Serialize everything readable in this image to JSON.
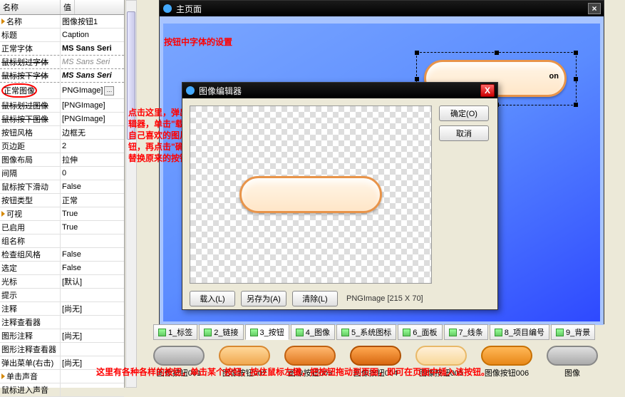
{
  "propGrid": {
    "headers": {
      "name": "名称",
      "value": "值"
    },
    "rows": [
      {
        "l": "名称",
        "r": "图像按钮1",
        "tri": true
      },
      {
        "l": "标题",
        "r": "Caption"
      },
      {
        "l": "正常字体",
        "r": "MS Sans Seri",
        "dash": true,
        "boldR": true
      },
      {
        "l": "鼠标划过字体",
        "r": "MS Sans Seri",
        "dash": true,
        "strikeL": true,
        "italGR": true
      },
      {
        "l": "鼠标按下字体",
        "r": "MS Sans Seri",
        "dash": true,
        "strikeL": true,
        "italBR": true
      },
      {
        "l": "正常图像",
        "r": "PNGImage]",
        "circleL": true,
        "dots": true
      },
      {
        "l": "鼠标划过图像",
        "r": "[PNGImage]",
        "strikeL": true
      },
      {
        "l": "鼠标按下图像",
        "r": "[PNGImage]",
        "strikeL": true
      },
      {
        "l": "按钮风格",
        "r": "边框无"
      },
      {
        "l": "页边距",
        "r": "2"
      },
      {
        "l": "图像布局",
        "r": "拉伸"
      },
      {
        "l": "间隔",
        "r": "0"
      },
      {
        "l": "鼠标按下滑动",
        "r": "False"
      },
      {
        "l": "按钮类型",
        "r": "正常"
      },
      {
        "l": "可视",
        "r": "True",
        "tri": true
      },
      {
        "l": "已启用",
        "r": "True"
      },
      {
        "l": "组名称",
        "r": ""
      },
      {
        "l": "检查组风格",
        "r": "False"
      },
      {
        "l": "选定",
        "r": "False"
      },
      {
        "l": "光标",
        "r": "[默认]"
      },
      {
        "l": "提示",
        "r": ""
      },
      {
        "l": "注释",
        "r": "[尚无]"
      },
      {
        "l": "注释查看器",
        "r": ""
      },
      {
        "l": "图形注释",
        "r": "[尚无]"
      },
      {
        "l": "图形注释查看器",
        "r": ""
      },
      {
        "l": "弹出菜单(右击)",
        "r": "[尚无]"
      },
      {
        "l": "单击声音",
        "r": "",
        "tri": true
      },
      {
        "l": "鼠标进入声音",
        "r": ""
      }
    ]
  },
  "mainWin": {
    "title": "主页面",
    "btnCaption": "on"
  },
  "note1": "按钮中字体的设置",
  "note2": "点击这里，弹出图像编辑器，单击\"载入\"选择自己喜欢的图片或按钮，再点击\"确定\"即可替换原来的按钮。",
  "imgEditor": {
    "title": "图像编辑器",
    "ok": "确定(O)",
    "cancel": "取消",
    "load": "载入(L)",
    "saveas": "另存为(A)",
    "clear": "清除(L)",
    "info": "PNGImage  [215 X 70]"
  },
  "tabs": [
    "1_标签",
    "2_链接",
    "3_按钮",
    "4_图像",
    "5_系统图标",
    "6_面板",
    "7_线条",
    "8_项目编号",
    "9_背景"
  ],
  "activeTab": 2,
  "gallery": [
    "图像按钮001",
    "图像按钮002",
    "图像按钮003",
    "图像按钮004",
    "图像按钮005",
    "图像按钮006",
    "图像"
  ],
  "note3": "这里有各种各样的按钮，单击某个按钮，按住鼠标左键，把按钮拖动到页面，即可在页面中插入该按钮。"
}
